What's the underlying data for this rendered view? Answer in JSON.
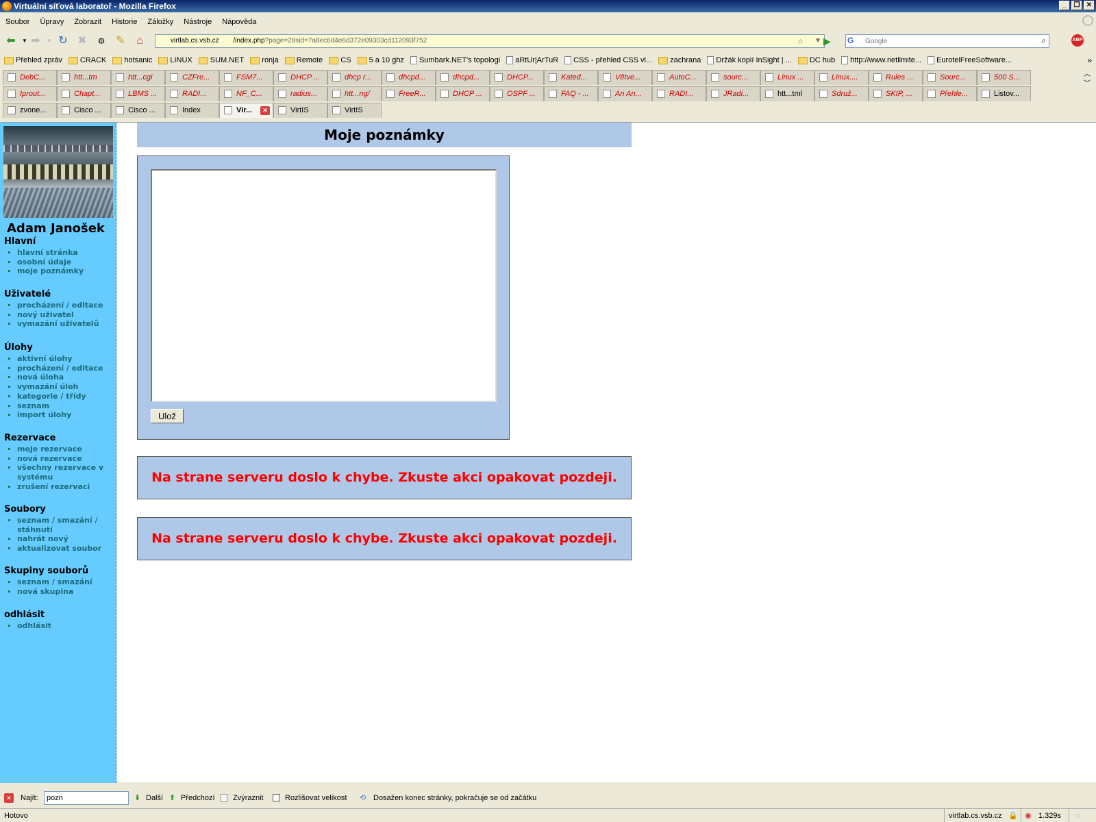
{
  "window": {
    "title": "Virtuální síťová laboratoř - Mozilla Firefox"
  },
  "menu": [
    "Soubor",
    "Úpravy",
    "Zobrazit",
    "Historie",
    "Záložky",
    "Nástroje",
    "Nápověda"
  ],
  "address": {
    "host": "virtlab.cs.vsb.cz",
    "path": "/index.php",
    "query": "?page=28sid=7a8ec6d4e6d372e09303cd112093f752"
  },
  "search": {
    "engine": "G",
    "placeholder": "Google"
  },
  "bookmarks": [
    {
      "label": "Přehled zpráv",
      "icon": "folder"
    },
    {
      "label": "CRACK",
      "icon": "folder"
    },
    {
      "label": "hotsanic",
      "icon": "folder"
    },
    {
      "label": "LINUX",
      "icon": "folder"
    },
    {
      "label": "SUM.NET",
      "icon": "folder"
    },
    {
      "label": "ronja",
      "icon": "folder"
    },
    {
      "label": "Remote",
      "icon": "folder"
    },
    {
      "label": "CS",
      "icon": "folder"
    },
    {
      "label": "5 a 10 ghz",
      "icon": "folder"
    },
    {
      "label": "Sumbark.NET's topologi",
      "icon": "page"
    },
    {
      "label": "aRtUr|ArTuR",
      "icon": "page"
    },
    {
      "label": "CSS - přehled CSS vl...",
      "icon": "page"
    },
    {
      "label": "zachrana",
      "icon": "folder"
    },
    {
      "label": "Držák kopií InSight | ...",
      "icon": "page"
    },
    {
      "label": "DC hub",
      "icon": "folder"
    },
    {
      "label": "http://www.netlimite...",
      "icon": "page"
    },
    {
      "label": "EurotelFreeSoftware...",
      "icon": "page"
    }
  ],
  "tab_rows": [
    [
      {
        "label": "DebC..."
      },
      {
        "label": "htt...tm"
      },
      {
        "label": "htt...cgi"
      },
      {
        "label": "CZFre..."
      },
      {
        "label": "FSM7..."
      },
      {
        "label": "DHCP ..."
      },
      {
        "label": "dhcp r..."
      },
      {
        "label": "dhcpd..."
      },
      {
        "label": "dhcpd..."
      },
      {
        "label": "DHCP..."
      },
      {
        "label": "Kated..."
      },
      {
        "label": "Větve..."
      },
      {
        "label": "AutoC..."
      },
      {
        "label": "sourc..."
      },
      {
        "label": "Linux ..."
      },
      {
        "label": "Linux...."
      },
      {
        "label": "Rules ..."
      },
      {
        "label": "Sourc..."
      },
      {
        "label": "500 S..."
      }
    ],
    [
      {
        "label": "Iprout..."
      },
      {
        "label": "Chapt..."
      },
      {
        "label": "LBMS ..."
      },
      {
        "label": "RADI..."
      },
      {
        "label": "NF_C..."
      },
      {
        "label": "radius..."
      },
      {
        "label": "htt...ng/"
      },
      {
        "label": "FreeR..."
      },
      {
        "label": "DHCP ..."
      },
      {
        "label": "OSPF ..."
      },
      {
        "label": "FAQ - ..."
      },
      {
        "label": "An An..."
      },
      {
        "label": "RADI..."
      },
      {
        "label": "JRadi..."
      },
      {
        "label": "htt...tml",
        "plain": true
      },
      {
        "label": "Sdruž..."
      },
      {
        "label": "SKIP, ..."
      },
      {
        "label": "Přehle..."
      },
      {
        "label": "Listov...",
        "plain": true
      }
    ],
    [
      {
        "label": "zvone...",
        "plain": true
      },
      {
        "label": "Cisco ...",
        "plain": true
      },
      {
        "label": "Cisco ...",
        "plain": true
      },
      {
        "label": "Index",
        "plain": true
      },
      {
        "label": "Vir...",
        "active": true
      },
      {
        "label": "VirtIS",
        "plain": true
      },
      {
        "label": "VirtIS",
        "plain": true
      }
    ]
  ],
  "sidebar": {
    "user_name": "Adam Janošek",
    "sections": [
      {
        "title": "Hlavní",
        "items": [
          "hlavní stránka",
          "osobní údaje",
          "moje poznámky"
        ]
      },
      {
        "title": "Uživatelé",
        "items": [
          "procházení / editace",
          "nový uživatel",
          "vymazání uživatelů"
        ]
      },
      {
        "title": "Úlohy",
        "items": [
          "aktivní úlohy",
          "procházení / editace",
          "nová úloha",
          "vymazání úloh",
          "kategorie / třídy",
          "seznam",
          "import úlohy"
        ]
      },
      {
        "title": "Rezervace",
        "items": [
          "moje rezervace",
          "nová rezervace",
          "všechny rezervace v systému",
          "zrušení rezervací"
        ]
      },
      {
        "title": "Soubory",
        "items": [
          "seznam / smazání / stáhnutí",
          "nahrát nový",
          "aktualizovat soubor"
        ]
      },
      {
        "title": "Skupiny souborů",
        "items": [
          "seznam / smazání",
          "nová skupina"
        ]
      },
      {
        "title": "odhlásit",
        "items": [
          "odhlásit"
        ]
      }
    ]
  },
  "main": {
    "title": "Moje poznámky",
    "notes_value": "",
    "save_label": "Ulož",
    "errors": [
      "Na strane serveru doslo k chybe. Zkuste akci opakovat pozdeji.",
      "Na strane serveru doslo k chybe. Zkuste akci opakovat pozdeji."
    ]
  },
  "findbar": {
    "label": "Najít:",
    "value": "pozn",
    "next": "Další",
    "prev": "Předchozí",
    "highlight": "Zvýraznit",
    "match_case": "Rozlišovat velikost",
    "message": "Dosažen konec stránky, pokračuje se od začátku"
  },
  "status": {
    "text": "Hotovo",
    "host": "virtlab.cs.vsb.cz",
    "timer": "1.329s"
  }
}
